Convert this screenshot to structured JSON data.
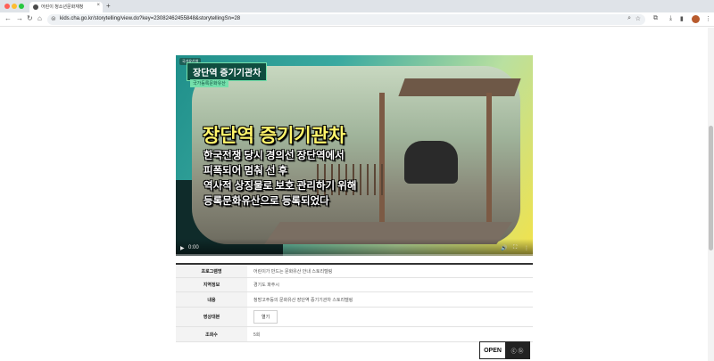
{
  "browser": {
    "tab_title": "어린이 청소년문화재청",
    "tab_close": "×",
    "new_tab": "+",
    "url": "kids.cha.go.kr/storytelling/view.do?key=23082462455848&storytellingSn=28",
    "nav_back": "←",
    "nav_forward": "→",
    "nav_reload": "↻",
    "nav_home": "⌂"
  },
  "video": {
    "badge": "국가유산청",
    "title_box": "장단역 증기기관차",
    "subtitle_box": "국가등록문화유산",
    "caption_title": "장단역 증기기관차",
    "caption_lines": [
      "한국전쟁 당시 경의선 장단역에서",
      "피폭되어 멈춰 선 후",
      "역사적 상징물로 보호 관리하기 위해",
      "등록문화유산으로 등록되었다"
    ],
    "time_current": "0:00",
    "play_icon": "▶"
  },
  "info": {
    "rows": [
      {
        "label": "프로그램명",
        "value": "어린이가 만드는 문화유산 안내 스토리텔링"
      },
      {
        "label": "지역정보",
        "value": "경기도 파주시"
      },
      {
        "label": "내용",
        "value": "청방고주등의 문화유산 장단역 증기기관차 스토리텔링"
      },
      {
        "label": "영상대본",
        "value": "열기"
      },
      {
        "label": "조회수",
        "value": "5회"
      }
    ]
  },
  "license": {
    "open": "OPEN",
    "icons": "ⓒ ⓑ"
  }
}
